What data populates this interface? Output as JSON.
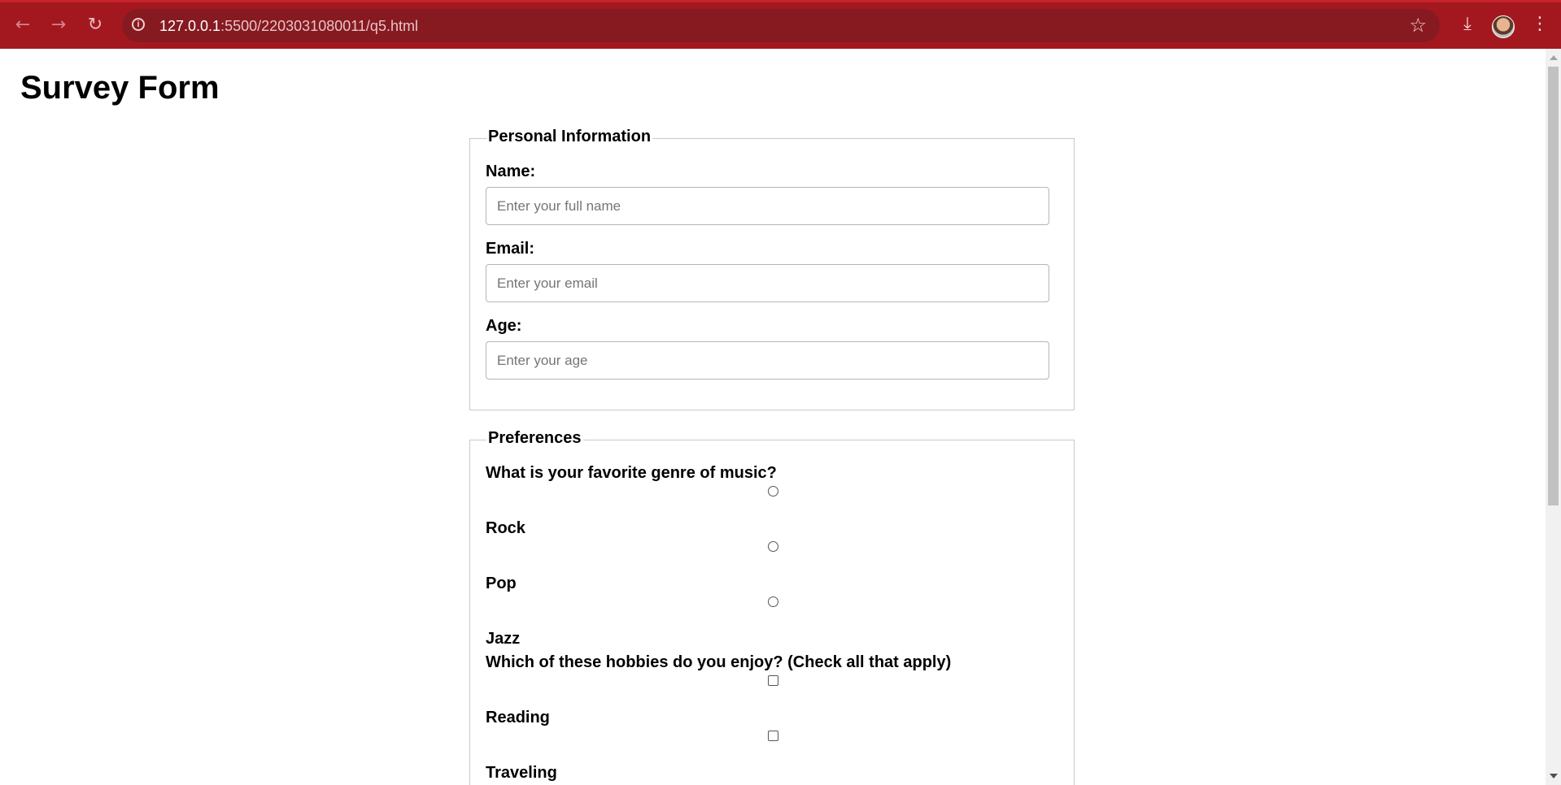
{
  "browser": {
    "url_host": "127.0.0.1",
    "url_path": ":5500/2203031080011/q5.html",
    "back_icon": "arrow-left",
    "forward_icon": "arrow-right",
    "reload_icon": "reload",
    "star_icon": "star",
    "download_icon": "download",
    "menu_icon": "kebab-menu"
  },
  "page": {
    "title": "Survey Form"
  },
  "personal": {
    "legend": "Personal Information",
    "name_label": "Name:",
    "name_placeholder": "Enter your full name",
    "email_label": "Email:",
    "email_placeholder": "Enter your email",
    "age_label": "Age:",
    "age_placeholder": "Enter your age"
  },
  "preferences": {
    "legend": "Preferences",
    "genre_question": "What is your favorite genre of music?",
    "genres": [
      "Rock",
      "Pop",
      "Jazz"
    ],
    "hobby_question": "Which of these hobbies do you enjoy? (Check all that apply)",
    "hobbies": [
      "Reading",
      "Traveling"
    ]
  },
  "colors": {
    "chrome": "#a3181f",
    "omnibox": "#861a20"
  }
}
